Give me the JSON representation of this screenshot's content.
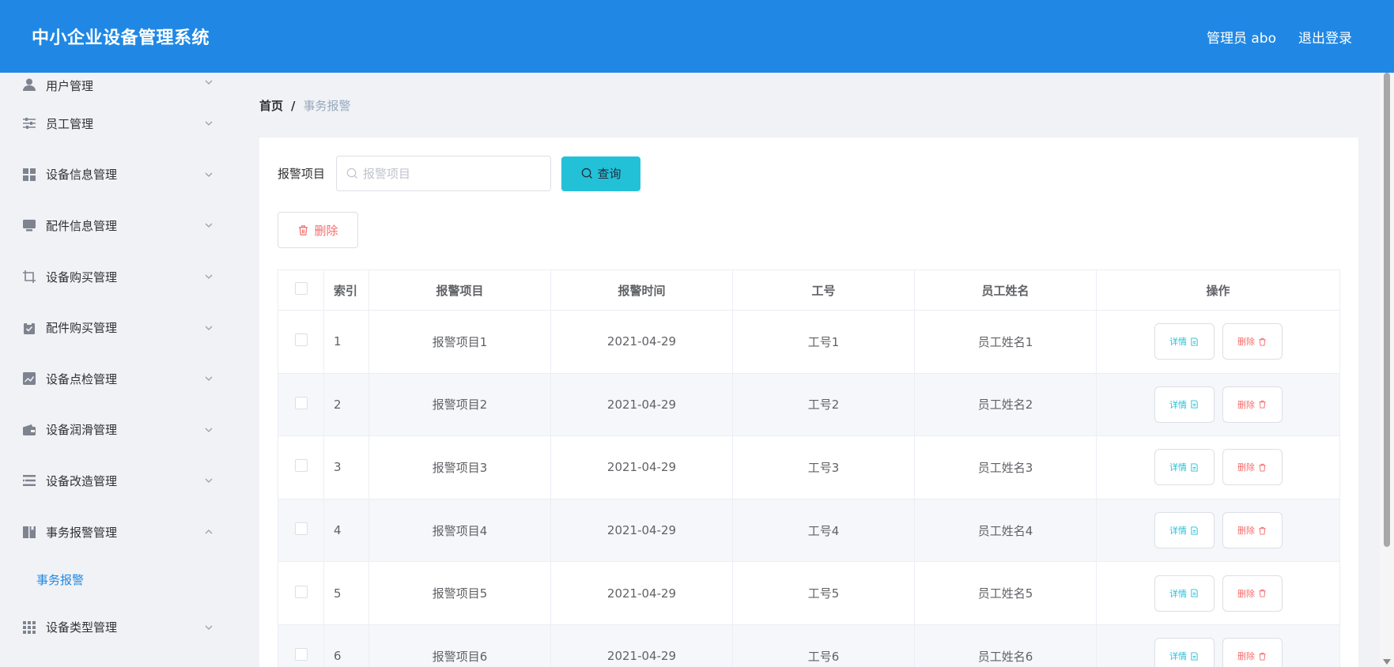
{
  "header": {
    "title": "中小企业设备管理系统",
    "user": "管理员 abo",
    "logout": "退出登录"
  },
  "sidebar": {
    "items": [
      {
        "label": "用户管理",
        "icon": "user-icon",
        "expanded": false
      },
      {
        "label": "员工管理",
        "icon": "sliders-icon",
        "expanded": false
      },
      {
        "label": "设备信息管理",
        "icon": "grid-icon",
        "expanded": false
      },
      {
        "label": "配件信息管理",
        "icon": "monitor-icon",
        "expanded": false
      },
      {
        "label": "设备购买管理",
        "icon": "crop-icon",
        "expanded": false
      },
      {
        "label": "配件购买管理",
        "icon": "clipboard-icon",
        "expanded": false
      },
      {
        "label": "设备点检管理",
        "icon": "chart-icon",
        "expanded": false
      },
      {
        "label": "设备润滑管理",
        "icon": "wallet-icon",
        "expanded": false
      },
      {
        "label": "设备改造管理",
        "icon": "list-icon",
        "expanded": false
      },
      {
        "label": "事务报警管理",
        "icon": "book-icon",
        "expanded": true
      },
      {
        "label": "设备类型管理",
        "icon": "apps-icon",
        "expanded": false
      }
    ],
    "submenu": {
      "label": "事务报警"
    }
  },
  "breadcrumb": {
    "home": "首页",
    "separator": "/",
    "current": "事务报警"
  },
  "search": {
    "label": "报警项目",
    "placeholder": "报警项目",
    "query_label": "查询"
  },
  "toolbar": {
    "delete_label": "删除"
  },
  "table": {
    "headers": [
      "索引",
      "报警项目",
      "报警时间",
      "工号",
      "员工姓名",
      "操作"
    ],
    "rows": [
      {
        "index": "1",
        "item": "报警项目1",
        "time": "2021-04-29",
        "emp_no": "工号1",
        "emp_name": "员工姓名1"
      },
      {
        "index": "2",
        "item": "报警项目2",
        "time": "2021-04-29",
        "emp_no": "工号2",
        "emp_name": "员工姓名2"
      },
      {
        "index": "3",
        "item": "报警项目3",
        "time": "2021-04-29",
        "emp_no": "工号3",
        "emp_name": "员工姓名3"
      },
      {
        "index": "4",
        "item": "报警项目4",
        "time": "2021-04-29",
        "emp_no": "工号4",
        "emp_name": "员工姓名4"
      },
      {
        "index": "5",
        "item": "报警项目5",
        "time": "2021-04-29",
        "emp_no": "工号5",
        "emp_name": "员工姓名5"
      },
      {
        "index": "6",
        "item": "报警项目6",
        "time": "2021-04-29",
        "emp_no": "工号6",
        "emp_name": "员工姓名6"
      }
    ],
    "detail_label": "详情",
    "delete_label": "删除"
  },
  "colors": {
    "primary": "#2088e4",
    "accent": "#23c1d8",
    "danger": "#f56c6c"
  }
}
